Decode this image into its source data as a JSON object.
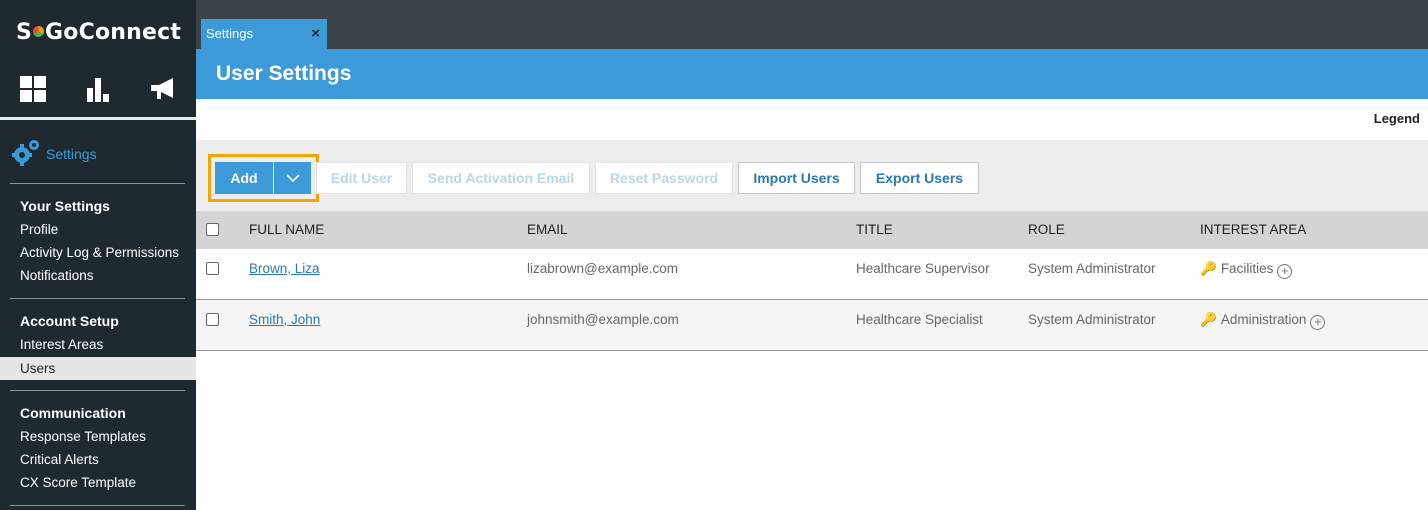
{
  "app": {
    "logo_text_before": "S",
    "logo_text_after": "GoConnect"
  },
  "sidebar": {
    "top_icons": [
      "dashboard-icon",
      "chart-icon",
      "megaphone-icon"
    ],
    "section_label": "Settings",
    "groups": [
      {
        "title": "Your Settings",
        "items": [
          "Profile",
          "Activity Log & Permissions",
          "Notifications"
        ]
      },
      {
        "title": "Account Setup",
        "items": [
          "Interest Areas",
          "Users"
        ]
      },
      {
        "title": "Communication",
        "items": [
          "Response Templates",
          "Critical Alerts",
          "CX Score Template"
        ]
      }
    ],
    "active_item": "Users"
  },
  "tabs": [
    {
      "label": "Settings",
      "close": "×"
    }
  ],
  "page": {
    "title": "User Settings",
    "legend": "Legend"
  },
  "toolbar": {
    "add_label": "Add",
    "buttons": [
      {
        "label": "Edit User",
        "enabled": false
      },
      {
        "label": "Send Activation Email",
        "enabled": false
      },
      {
        "label": "Reset Password",
        "enabled": false
      },
      {
        "label": "Import Users",
        "enabled": true
      },
      {
        "label": "Export Users",
        "enabled": true
      }
    ]
  },
  "table": {
    "columns": [
      "FULL NAME",
      "EMAIL",
      "TITLE",
      "ROLE",
      "INTEREST AREA"
    ],
    "rows": [
      {
        "name": "Brown, Liza",
        "email": "lizabrown@example.com",
        "title": "Healthcare Supervisor",
        "role": "System Administrator",
        "interest": "Facilities"
      },
      {
        "name": "Smith, John",
        "email": "johnsmith@example.com",
        "title": "Healthcare Specialist",
        "role": "System Administrator",
        "interest": "Administration"
      }
    ]
  },
  "colors": {
    "accent": "#3d9ad9",
    "sidebar": "#1f2a30",
    "highlight": "#f5a500"
  }
}
